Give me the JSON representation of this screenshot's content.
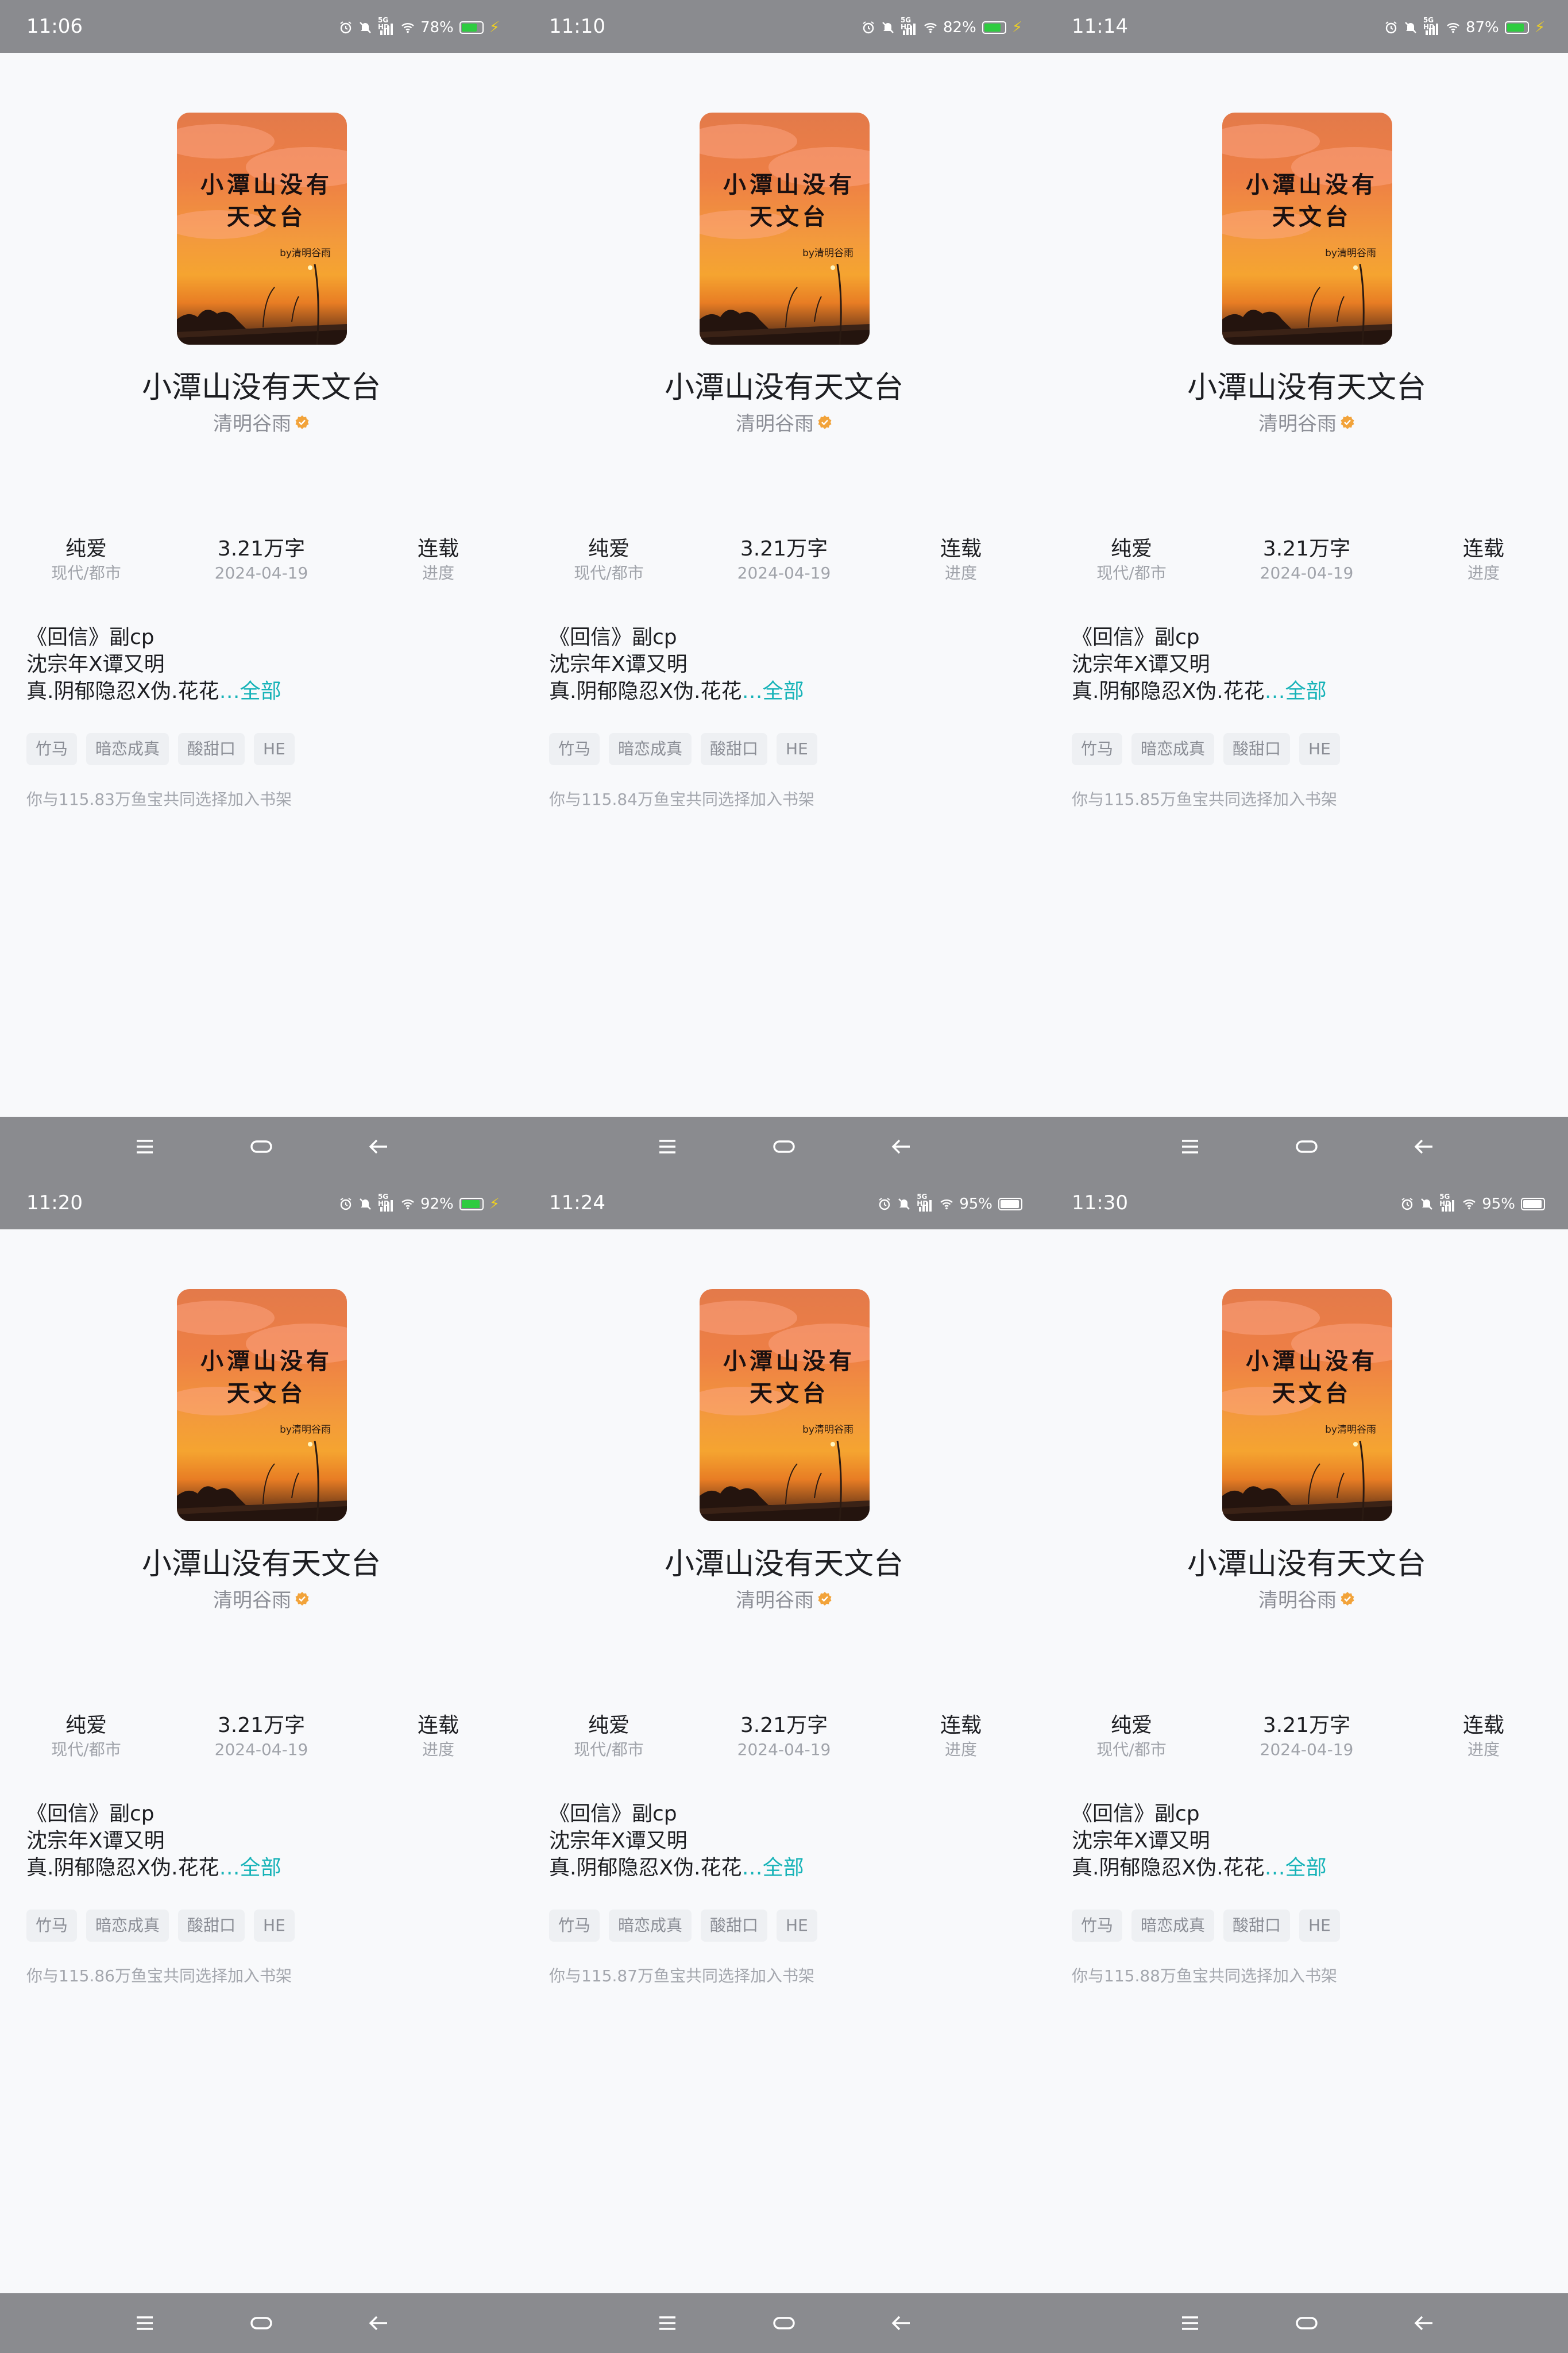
{
  "book": {
    "title": "小潭山没有天文台",
    "author": "清明谷雨",
    "cover_title_line1": "小潭山没有",
    "cover_title_line2": "天文台",
    "cover_byline": "by清明谷雨",
    "stats": [
      {
        "main": "纯爱",
        "sub": "现代/都市"
      },
      {
        "main": "3.21万字",
        "sub": "2024-04-19"
      },
      {
        "main": "连载",
        "sub": "进度"
      }
    ],
    "intro_lines": [
      "《回信》副cp",
      "沈宗年X谭又明",
      "真.阴郁隐忍X伪.花花"
    ],
    "intro_more": "…全部",
    "tags": [
      "竹马",
      "暗恋成真",
      "酸甜口",
      "HE"
    ]
  },
  "colors": {
    "accent": "#17b3b8",
    "verified_badge": "#f2a33a",
    "battery_green": "#2ecc40",
    "battery_white": "#ffffff",
    "charge_bolt": "#f0d020"
  },
  "screens": [
    {
      "time": "11:06",
      "battery_pct": "78%",
      "battery_level": 0.78,
      "battery_color": "#2ecc40",
      "charging": true,
      "shelf_note": "你与115.83万鱼宝共同选择加入书架"
    },
    {
      "time": "11:10",
      "battery_pct": "82%",
      "battery_level": 0.82,
      "battery_color": "#2ecc40",
      "charging": true,
      "shelf_note": "你与115.84万鱼宝共同选择加入书架"
    },
    {
      "time": "11:14",
      "battery_pct": "87%",
      "battery_level": 0.87,
      "battery_color": "#2ecc40",
      "charging": true,
      "shelf_note": "你与115.85万鱼宝共同选择加入书架"
    },
    {
      "time": "11:20",
      "battery_pct": "92%",
      "battery_level": 0.92,
      "battery_color": "#2ecc40",
      "charging": true,
      "shelf_note": "你与115.86万鱼宝共同选择加入书架"
    },
    {
      "time": "11:24",
      "battery_pct": "95%",
      "battery_level": 0.95,
      "battery_color": "#ffffff",
      "charging": false,
      "shelf_note": "你与115.87万鱼宝共同选择加入书架"
    },
    {
      "time": "11:30",
      "battery_pct": "95%",
      "battery_level": 0.95,
      "battery_color": "#ffffff",
      "charging": false,
      "shelf_note": "你与115.88万鱼宝共同选择加入书架"
    }
  ],
  "status_icons": [
    "alarm-icon",
    "mute-icon",
    "signal-5g-icon",
    "wifi-icon",
    "battery-icon"
  ],
  "status_network_label": "5G HD",
  "charging_symbol": "⚡",
  "nav_icons": [
    "menu-icon",
    "home-icon",
    "back-icon"
  ]
}
